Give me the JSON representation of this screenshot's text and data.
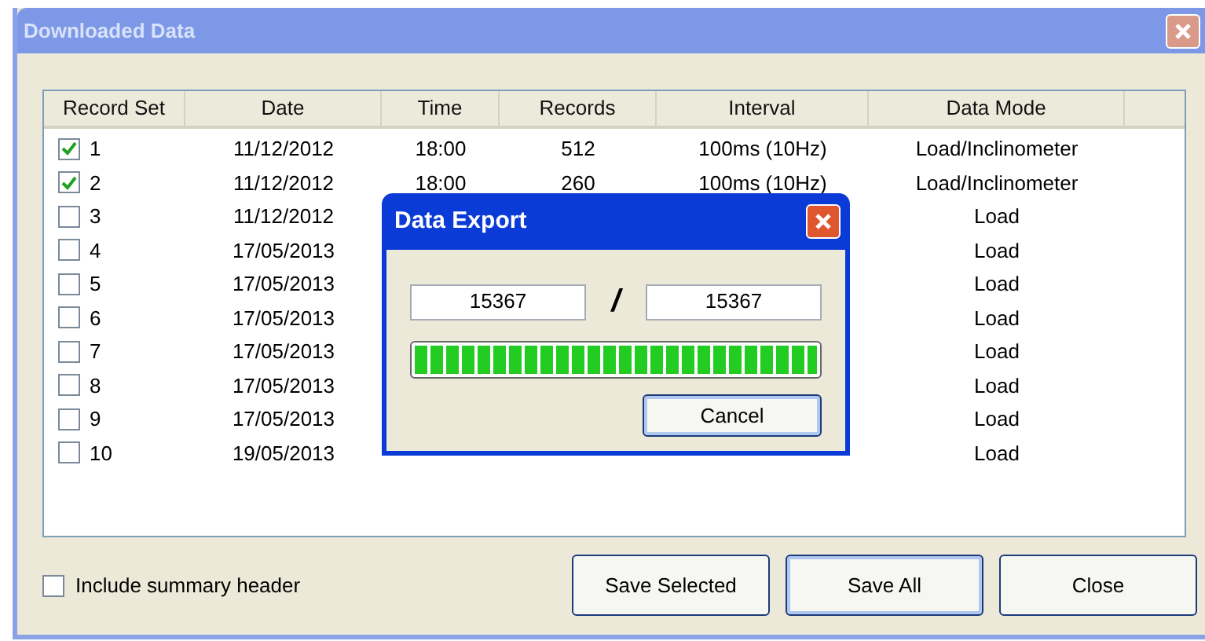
{
  "window": {
    "title": "Downloaded Data",
    "active": false
  },
  "table": {
    "columns": [
      "Record Set",
      "Date",
      "Time",
      "Records",
      "Interval",
      "Data Mode"
    ],
    "rows": [
      {
        "checked": true,
        "record_set": "1",
        "date": "11/12/2012",
        "time": "18:00",
        "records": "512",
        "interval": "100ms (10Hz)",
        "data_mode": "Load/Inclinometer"
      },
      {
        "checked": true,
        "record_set": "2",
        "date": "11/12/2012",
        "time": "18:00",
        "records": "260",
        "interval": "100ms (10Hz)",
        "data_mode": "Load/Inclinometer"
      },
      {
        "checked": false,
        "record_set": "3",
        "date": "11/12/2012",
        "data_mode": "Load"
      },
      {
        "checked": false,
        "record_set": "4",
        "date": "17/05/2013",
        "data_mode": "Load"
      },
      {
        "checked": false,
        "record_set": "5",
        "date": "17/05/2013",
        "data_mode": "Load"
      },
      {
        "checked": false,
        "record_set": "6",
        "date": "17/05/2013",
        "data_mode": "Load"
      },
      {
        "checked": false,
        "record_set": "7",
        "date": "17/05/2013",
        "data_mode": "Load"
      },
      {
        "checked": false,
        "record_set": "8",
        "date": "17/05/2013",
        "data_mode": "Load"
      },
      {
        "checked": false,
        "record_set": "9",
        "date": "17/05/2013",
        "data_mode": "Load"
      },
      {
        "checked": false,
        "record_set": "10",
        "date": "19/05/2013",
        "data_mode": "Load"
      }
    ]
  },
  "include_summary_header": {
    "label": "Include summary header",
    "checked": false
  },
  "buttons": [
    "Save Selected",
    "Save All",
    "Close"
  ],
  "export_dialog": {
    "title": "Data Export",
    "current": "15367",
    "separator": "/",
    "total": "15367",
    "progress": {
      "level": 1
    },
    "button": "Cancel"
  }
}
